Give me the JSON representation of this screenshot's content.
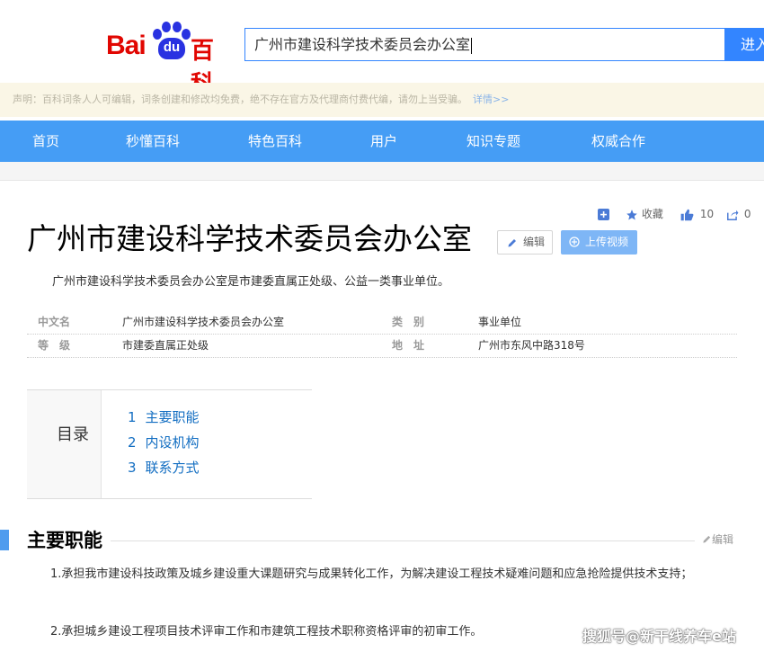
{
  "header": {
    "logo_text_left": "Bai",
    "logo_text_paw": "du",
    "logo_text_right": "百科",
    "search_value": "广州市建设科学技术委员会办公室",
    "search_button": "进入"
  },
  "notice": {
    "text": "声明：百科词条人人可编辑，词条创建和修改均免费，绝不存在官方及代理商付费代编，请勿上当受骗。",
    "more_link": "详情>>"
  },
  "nav": {
    "items": [
      "首页",
      "秒懂百科",
      "特色百科",
      "用户",
      "知识专题",
      "权威合作"
    ]
  },
  "tools": {
    "collect_label": "收藏",
    "like_count": "10",
    "share_count": "0"
  },
  "article": {
    "title": "广州市建设科学技术委员会办公室",
    "edit_label": "编辑",
    "upload_label": "上传视频",
    "summary": "广州市建设科学技术委员会办公室是市建委直属正处级、公益一类事业单位。",
    "info": [
      {
        "key": "中文名",
        "value": "广州市建设科学技术委员会办公室"
      },
      {
        "key": "类　别",
        "value": "事业单位"
      },
      {
        "key": "等　级",
        "value": "市建委直属正处级"
      },
      {
        "key": "地　址",
        "value": "广州市东风中路318号"
      }
    ]
  },
  "toc": {
    "label": "目录",
    "items": [
      {
        "num": "1",
        "label": "主要职能"
      },
      {
        "num": "2",
        "label": "内设机构"
      },
      {
        "num": "3",
        "label": "联系方式"
      }
    ]
  },
  "section": {
    "title": "主要职能",
    "edit_label": "编辑",
    "paragraphs": [
      "1.承担我市建设科技政策及城乡建设重大课题研究与成果转化工作，为解决建设工程技术疑难问题和应急抢险提供技术支持；",
      "2.承担城乡建设工程项目技术评审工作和市建筑工程技术职称资格评审的初审工作。"
    ]
  },
  "watermark": "搜狐号@新干线养车e站",
  "colors": {
    "brand_red": "#e10601",
    "brand_blue": "#2932e1",
    "nav_blue": "#459df5",
    "link_blue": "#136ec2"
  }
}
